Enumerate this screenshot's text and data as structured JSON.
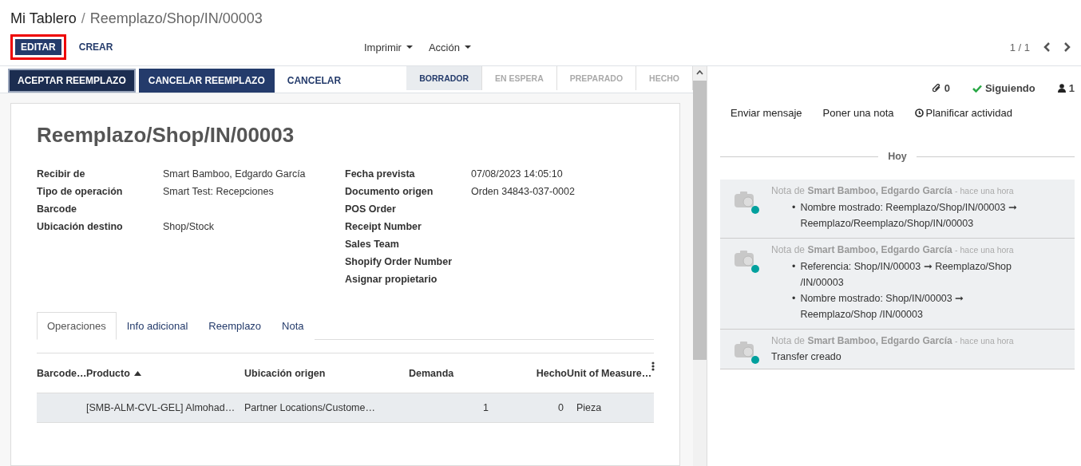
{
  "breadcrumb": [
    {
      "label": "Mi Tablero",
      "current": false
    },
    {
      "separator": "/",
      "label": "Reemplazo/Shop/IN/00003",
      "current": true
    }
  ],
  "control_buttons": [
    {
      "label": "EDITAR",
      "kind": "primary",
      "highlighted": true
    },
    {
      "label": "CREAR",
      "kind": "link",
      "highlighted": false
    }
  ],
  "dropdowns": [
    "Imprimir",
    "Acción"
  ],
  "pager": "1 / 1",
  "action_buttons": [
    {
      "label": "ACEPTAR REEMPLAZO",
      "kind": "dark"
    },
    {
      "label": "CANCELAR REEMPLAZO",
      "kind": "primary"
    },
    {
      "label": "CANCELAR",
      "kind": "link"
    }
  ],
  "stages": [
    {
      "label": "BORRADOR",
      "selected": true
    },
    {
      "label": "EN ESPERA",
      "selected": false
    },
    {
      "label": "PREPARADO",
      "selected": false
    },
    {
      "label": "HECHO",
      "selected": false
    }
  ],
  "form": {
    "title": "Reemplazo/Shop/IN/00003",
    "left_fields": [
      {
        "label": "Recibir de",
        "value": "Smart Bamboo, Edgardo García"
      },
      {
        "label": "Tipo de operación",
        "value": "Smart Test: Recepciones"
      },
      {
        "label": "Barcode"
      },
      {
        "label": "Ubicación destino",
        "value": "Shop/Stock"
      }
    ],
    "right_fields": [
      {
        "label": "Fecha prevista",
        "value": "07/08/2023 14:05:10"
      },
      {
        "label": "Documento origen",
        "value": "Orden 34843-037-0002"
      },
      {
        "label": "POS Order"
      },
      {
        "label": "Receipt Number"
      },
      {
        "label": "Sales Team"
      },
      {
        "label": "Shopify Order Number"
      },
      {
        "label": "Asignar propietario"
      }
    ],
    "tabs": [
      {
        "label": "Operaciones",
        "selected": true
      },
      {
        "label": "Info adicional",
        "selected": false
      },
      {
        "label": "Reemplazo",
        "selected": false
      },
      {
        "label": "Nota",
        "selected": false
      }
    ],
    "table": {
      "columns": [
        "Barcode…",
        "Producto",
        "Ubicación origen",
        "Demanda",
        "Hecho",
        "Unit of Measure…"
      ],
      "rows": [
        [
          "",
          "[SMB-ALM-CVL-GEL] Almohad…",
          "Partner Locations/Custome…",
          "1",
          "0",
          "Pieza"
        ]
      ]
    }
  },
  "chatter": {
    "attachments": "0",
    "follow": "Siguiendo",
    "followers": "1",
    "actions": [
      "Enviar mensaje",
      "Poner una nota",
      "Planificar actividad"
    ],
    "day": "Hoy",
    "messages": [
      {
        "prefix": "Nota de",
        "author": "Smart Bamboo, Edgardo García",
        "time": "- hace una hora",
        "items": [
          {
            "bullet": "•",
            "text": "Nombre mostrado: Reemplazo/Shop/IN/00003 ➞ Reemplazo/Reemplazo/Shop/IN/00003"
          }
        ]
      },
      {
        "prefix": "Nota de",
        "author": "Smart Bamboo, Edgardo García",
        "time": "- hace una hora",
        "items": [
          {
            "bullet": "•",
            "text": "Referencia: Shop/IN/00003 ➞ Reemplazo/Shop /IN/00003"
          },
          {
            "bullet": "•",
            "text": "Nombre mostrado: Shop/IN/00003 ➞ Reemplazo/Shop /IN/00003"
          }
        ]
      },
      {
        "prefix": "Nota de",
        "author": "Smart Bamboo, Edgardo García",
        "time": "- hace una hora",
        "body": "Transfer creado"
      }
    ]
  }
}
